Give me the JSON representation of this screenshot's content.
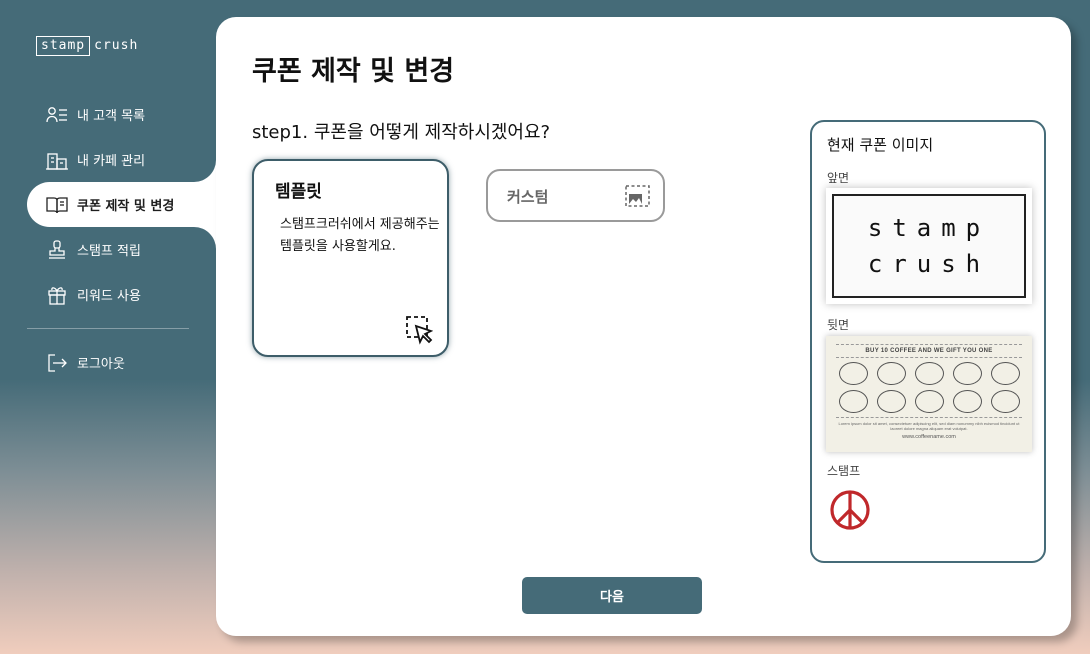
{
  "brand": {
    "logo_part1": "stamp",
    "logo_part2": "crush"
  },
  "nav": {
    "items": [
      {
        "label": "내 고객 목록",
        "icon": "users-icon",
        "active": false
      },
      {
        "label": "내 카페 관리",
        "icon": "building-icon",
        "active": false
      },
      {
        "label": "쿠폰 제작 및 변경",
        "icon": "book-icon",
        "active": true
      },
      {
        "label": "스탬프 적립",
        "icon": "stamp-icon",
        "active": false
      },
      {
        "label": "리워드 사용",
        "icon": "gift-icon",
        "active": false
      }
    ],
    "logout": {
      "label": "로그아웃",
      "icon": "logout-icon"
    }
  },
  "main": {
    "title": "쿠폰 제작 및 변경",
    "step_title": "step1. 쿠폰을 어떻게 제작하시겠어요?",
    "options": {
      "template": {
        "title": "템플릿",
        "desc": "스탬프크러쉬에서 제공해주는 템플릿을 사용할게요.",
        "icon": "select-cursor-icon",
        "selected": true
      },
      "custom": {
        "title": "커스텀",
        "icon": "image-icon",
        "selected": false
      }
    },
    "next_button": "다음"
  },
  "preview": {
    "title": "현재 쿠폰 이미지",
    "front_label": "앞면",
    "front_line1": "stamp",
    "front_line2": "crush",
    "back_label": "뒷면",
    "back_heading": "BUY 10 COFFEE AND WE GIFT YOU ONE",
    "back_small_text": "Lorem ipsum dolor sit amet, consectetuer adipiscing elit, sed diam nonummy nibh euismod tincidunt ut laoreet dolore magna aliquam erat volutpat.",
    "back_site": "www.coffeename.com",
    "stamp_count": 10,
    "stamp_label": "스탬프",
    "stamp_color": "#c0282b"
  },
  "colors": {
    "primary": "#456b78",
    "accent_red": "#c0282b"
  }
}
